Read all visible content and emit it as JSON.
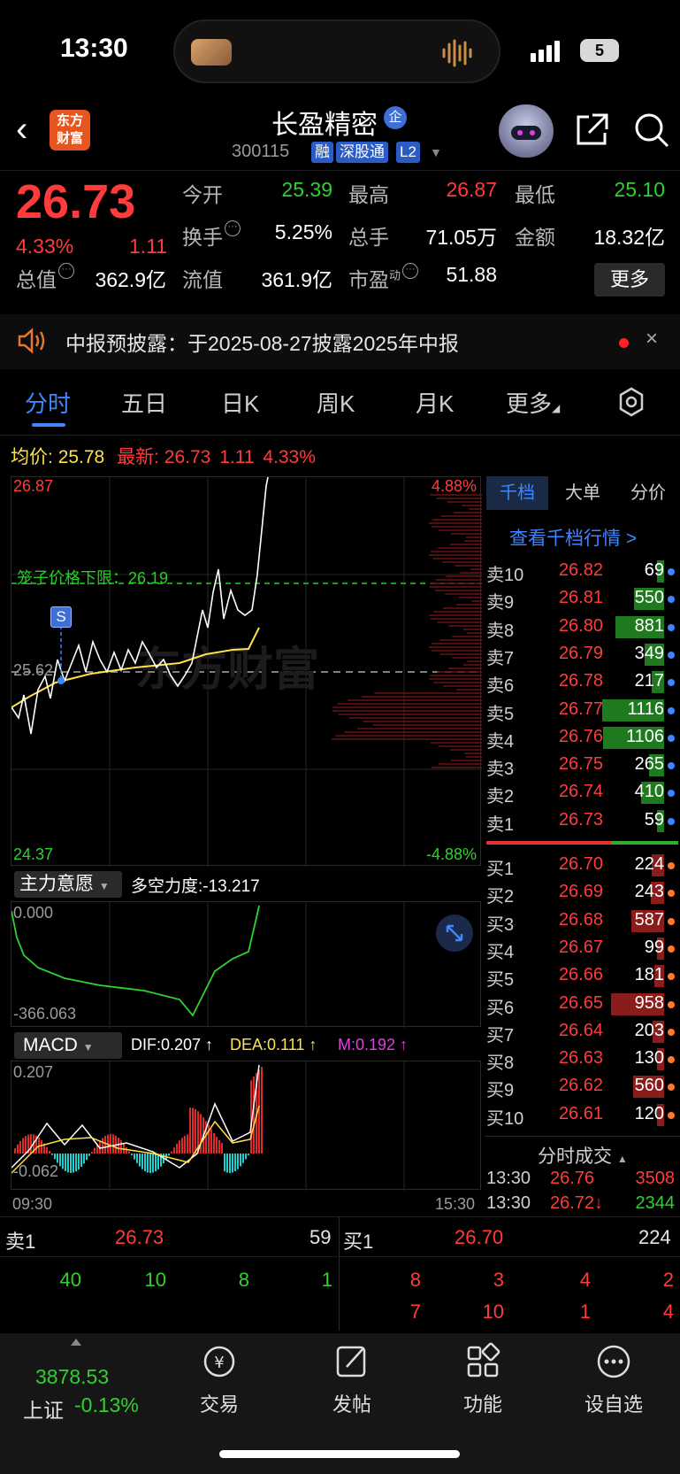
{
  "status": {
    "time": "13:30",
    "battery": "5"
  },
  "header": {
    "logo_line1": "东方",
    "logo_line2": "财富",
    "name": "长盈精密",
    "name_badge": "企",
    "code": "300115",
    "tags": [
      "融",
      "深股通",
      "L2"
    ]
  },
  "quote": {
    "price": "26.73",
    "change_pct": "4.33%",
    "change_abs": "1.11",
    "fields": {
      "open_label": "今开",
      "open": "25.39",
      "high_label": "最高",
      "high": "26.87",
      "low_label": "最低",
      "low": "25.10",
      "turnover_label": "换手",
      "turnover": "5.25%",
      "volume_label": "总手",
      "volume": "71.05万",
      "amount_label": "金额",
      "amount": "18.32亿",
      "mktcap_label": "总值",
      "mktcap": "362.9亿",
      "float_label": "流值",
      "float": "361.9亿",
      "pe_label": "市盈",
      "pe_sup": "动",
      "pe": "51.88"
    },
    "more_label": "更多"
  },
  "notice": {
    "text": "中报预披露：于2025-08-27披露2025年中报",
    "close": "×"
  },
  "tabs": [
    "分时",
    "五日",
    "日K",
    "周K",
    "月K",
    "更多"
  ],
  "info_line": {
    "avg_label": "均价:",
    "avg": "25.78",
    "latest_label": "最新:",
    "latest": "26.73",
    "chg": "1.11",
    "pct": "4.33%"
  },
  "chart": {
    "top_price": "26.87",
    "bottom_price": "24.37",
    "mid_price": "25.62",
    "top_pct": "4.88%",
    "bottom_pct": "-4.88%",
    "cage_label": "笼子价格下限：26.19",
    "s_marker": "S",
    "time_start": "09:30",
    "time_end": "15:30",
    "watermark": "东方财富"
  },
  "indicator": {
    "name": "主力意愿",
    "power": "多空力度:-13.217",
    "top": "0.000",
    "bottom": "-366.063"
  },
  "macd": {
    "name": "MACD",
    "dif": "DIF:0.207 ↑",
    "dea": "DEA:0.111 ↑",
    "m": "M:0.192 ↑",
    "top": "0.207",
    "bottom": "-0.062"
  },
  "order_panel": {
    "tabs": [
      "千档",
      "大单",
      "分价"
    ],
    "view_link": "查看千档行情 >",
    "asks": [
      {
        "label": "卖10",
        "price": "26.82",
        "vol": "69"
      },
      {
        "label": "卖9",
        "price": "26.81",
        "vol": "550"
      },
      {
        "label": "卖8",
        "price": "26.80",
        "vol": "881"
      },
      {
        "label": "卖7",
        "price": "26.79",
        "vol": "349"
      },
      {
        "label": "卖6",
        "price": "26.78",
        "vol": "217"
      },
      {
        "label": "卖5",
        "price": "26.77",
        "vol": "1116"
      },
      {
        "label": "卖4",
        "price": "26.76",
        "vol": "1106"
      },
      {
        "label": "卖3",
        "price": "26.75",
        "vol": "265"
      },
      {
        "label": "卖2",
        "price": "26.74",
        "vol": "410"
      },
      {
        "label": "卖1",
        "price": "26.73",
        "vol": "59"
      }
    ],
    "bids": [
      {
        "label": "买1",
        "price": "26.70",
        "vol": "224"
      },
      {
        "label": "买2",
        "price": "26.69",
        "vol": "243"
      },
      {
        "label": "买3",
        "price": "26.68",
        "vol": "587"
      },
      {
        "label": "买4",
        "price": "26.67",
        "vol": "99"
      },
      {
        "label": "买5",
        "price": "26.66",
        "vol": "181"
      },
      {
        "label": "买6",
        "price": "26.65",
        "vol": "958"
      },
      {
        "label": "买7",
        "price": "26.64",
        "vol": "203"
      },
      {
        "label": "买8",
        "price": "26.63",
        "vol": "130"
      },
      {
        "label": "买9",
        "price": "26.62",
        "vol": "560"
      },
      {
        "label": "买10",
        "price": "26.61",
        "vol": "120"
      }
    ],
    "trades_title": "分时成交",
    "trades": [
      {
        "time": "13:30",
        "price": "26.76",
        "vol": "3508"
      },
      {
        "time": "13:30",
        "price": "26.72↓",
        "vol": "2344"
      }
    ]
  },
  "bottom_summary": {
    "ask1_label": "卖1",
    "ask1_price": "26.73",
    "ask1_vol": "59",
    "bid1_label": "买1",
    "bid1_price": "26.70",
    "bid1_vol": "224",
    "ask_queue": [
      "40",
      "10",
      "8",
      "1"
    ],
    "bid_queue_row1": [
      "8",
      "3",
      "4",
      "2"
    ],
    "bid_queue_row2": [
      "7",
      "10",
      "1",
      "4"
    ]
  },
  "nav": {
    "index_value": "3878.53",
    "index_name": "上证",
    "index_change": "-0.13%",
    "items": [
      "交易",
      "发帖",
      "功能",
      "设自选"
    ]
  },
  "colors": {
    "up": "#ff3b3b",
    "down": "#2fd12f",
    "accent": "#3e86ff",
    "avg_line": "#ffe14a"
  }
}
